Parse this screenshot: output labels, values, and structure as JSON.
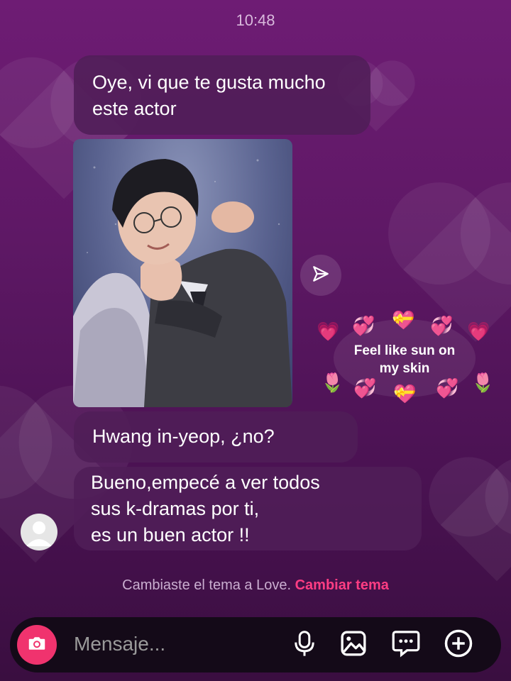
{
  "status": {
    "time": "10:48"
  },
  "messages": {
    "m1": {
      "lines": [
        "Oye, vi que te gusta mucho",
        "este actor"
      ]
    },
    "m2": {
      "text": "Hwang in-yeop, ¿no?"
    },
    "m3": {
      "lines": [
        "Bueno,empecé a ver todos",
        "sus k-dramas por ti,",
        "es un buen actor !!"
      ]
    }
  },
  "sticker": {
    "lines": [
      "Feel like sun on",
      "my skin"
    ]
  },
  "notice": {
    "text": "Cambiaste el tema a Love.",
    "action": "Cambiar tema"
  },
  "composer": {
    "placeholder": "Mensaje..."
  },
  "icons": [
    "share-icon",
    "camera-icon",
    "microphone-icon",
    "gallery-icon",
    "sticker-icon",
    "plus-icon"
  ],
  "colors": {
    "accent": "#f0336e",
    "link": "#ff3d83"
  }
}
